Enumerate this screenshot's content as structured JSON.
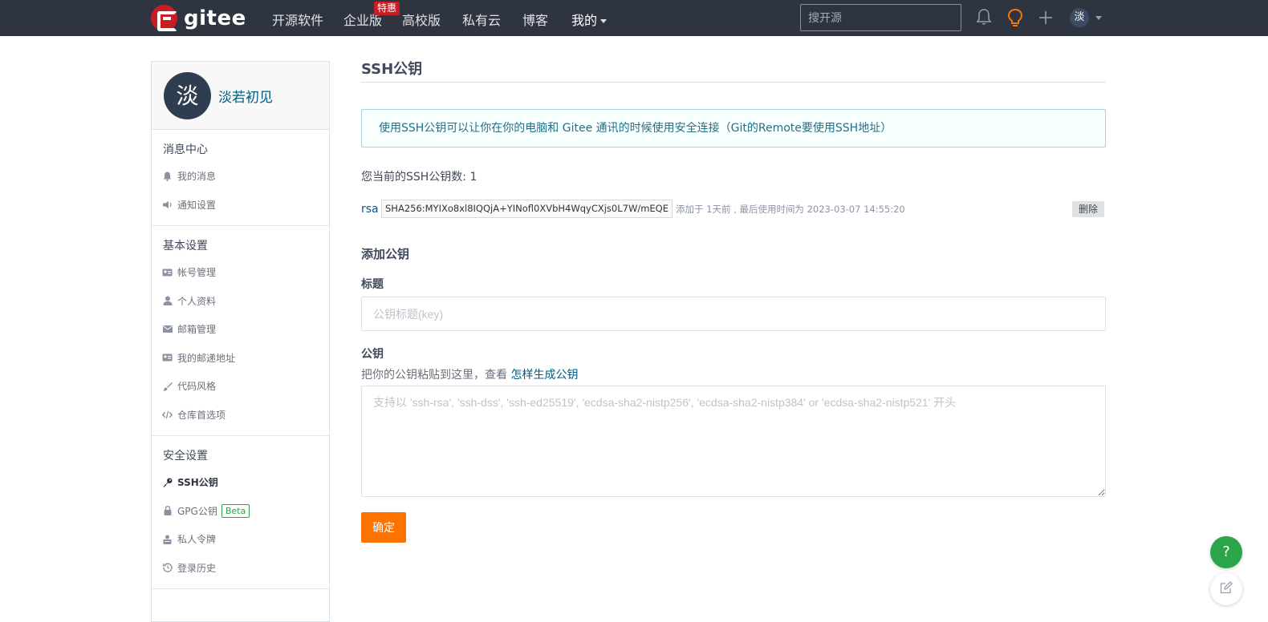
{
  "navbar": {
    "logo_text": "gitee",
    "items": [
      {
        "label": "开源软件"
      },
      {
        "label": "企业版",
        "badge": "特惠"
      },
      {
        "label": "高校版"
      },
      {
        "label": "私有云"
      },
      {
        "label": "博客"
      },
      {
        "label": "我的"
      }
    ],
    "search_placeholder": "搜开源",
    "avatar_char": "淡",
    "icons": [
      "bell-icon",
      "lightbulb-icon",
      "plus-icon"
    ]
  },
  "sidebar": {
    "avatar_char": "淡",
    "user_name": "淡若初见",
    "sections": [
      {
        "title": "消息中心",
        "items": [
          {
            "label": "我的消息",
            "icon": "bell-icon"
          },
          {
            "label": "通知设置",
            "icon": "megaphone-icon"
          }
        ]
      },
      {
        "title": "基本设置",
        "items": [
          {
            "label": "帐号管理",
            "icon": "id-card-icon"
          },
          {
            "label": "个人资料",
            "icon": "user-icon"
          },
          {
            "label": "邮箱管理",
            "icon": "envelope-icon"
          },
          {
            "label": "我的邮递地址",
            "icon": "address-card-icon"
          },
          {
            "label": "代码风格",
            "icon": "brush-icon"
          },
          {
            "label": "仓库首选项",
            "icon": "code-icon"
          }
        ]
      },
      {
        "title": "安全设置",
        "items": [
          {
            "label": "SSH公钥",
            "icon": "key-icon",
            "active": true
          },
          {
            "label": "GPG公钥",
            "icon": "lock-icon",
            "badge": "Beta"
          },
          {
            "label": "私人令牌",
            "icon": "token-icon"
          },
          {
            "label": "登录历史",
            "icon": "history-icon"
          }
        ]
      }
    ]
  },
  "main": {
    "title": "SSH公钥",
    "info": "使用SSH公钥可以让你在你的电脑和 Gitee 通讯的时候使用安全连接（Git的Remote要使用SSH地址）",
    "count_text": "您当前的SSH公钥数: 1",
    "key": {
      "type": "rsa",
      "fingerprint": "SHA256:MYIXo8xl8IQQjA+YINofl0XVbH4WqyCXjs0L7W/mEQE",
      "meta": "添加于 1天前 , 最后使用时间为 2023-03-07 14:55:20",
      "delete_label": "删除"
    },
    "add_title": "添加公钥",
    "title_label": "标题",
    "title_placeholder": "公钥标题(key)",
    "key_label": "公钥",
    "hint_text": "把你的公钥粘贴到这里，查看 ",
    "hint_link": "怎样生成公钥",
    "key_placeholder": "支持以 'ssh-rsa', 'ssh-dss', 'ssh-ed25519', 'ecdsa-sha2-nistp256', 'ecdsa-sha2-nistp384' or 'ecdsa-sha2-nistp521' 开头",
    "submit_label": "确定"
  },
  "fab": {
    "help_label": "?"
  },
  "colors": {
    "navbar_bg": "#2e3440",
    "brand_red": "#c71d23",
    "submit_orange": "#fe7300",
    "help_green": "#2ba44a",
    "link_blue": "#005980"
  }
}
